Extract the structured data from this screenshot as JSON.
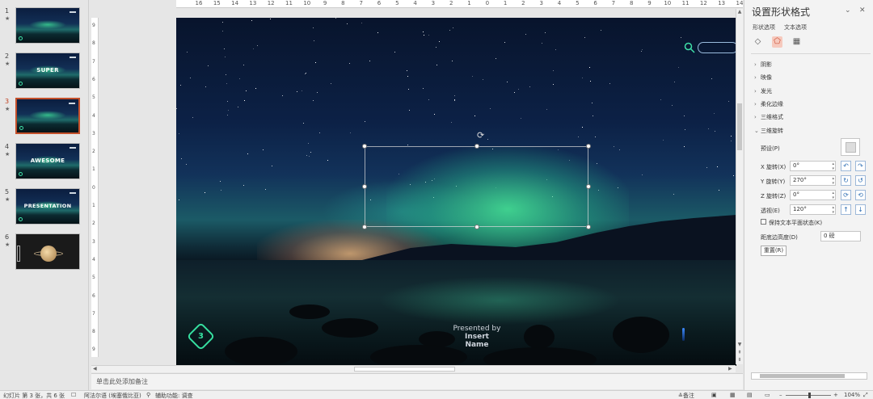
{
  "thumbnails": [
    {
      "num": "1",
      "star": "★",
      "word": "",
      "active": false
    },
    {
      "num": "2",
      "star": "★",
      "word": "SUPER",
      "active": false
    },
    {
      "num": "3",
      "star": "★",
      "word": "",
      "active": true
    },
    {
      "num": "4",
      "star": "★",
      "word": "AWESOME",
      "active": false
    },
    {
      "num": "5",
      "star": "★",
      "word": "PRESENTATION",
      "active": false
    },
    {
      "num": "6",
      "star": "★",
      "word": "",
      "active": false
    }
  ],
  "ruler": {
    "h_ticks": [
      "16",
      "15",
      "14",
      "13",
      "12",
      "11",
      "10",
      "9",
      "8",
      "7",
      "6",
      "5",
      "4",
      "3",
      "2",
      "1",
      "0",
      "1",
      "2",
      "3",
      "4",
      "5",
      "6",
      "7",
      "8",
      "9",
      "10",
      "11",
      "12",
      "13",
      "14"
    ],
    "v_ticks": [
      "9",
      "8",
      "7",
      "6",
      "5",
      "4",
      "3",
      "2",
      "1",
      "0",
      "1",
      "2",
      "3",
      "4",
      "5",
      "6",
      "7",
      "8",
      "9"
    ]
  },
  "slide": {
    "presented_line1": "Presented by",
    "presented_bold": "Insert",
    "presented_line2": "Name",
    "badge": "3"
  },
  "notes": {
    "placeholder": "单击此处添加备注"
  },
  "pane": {
    "title": "设置形状格式",
    "tabs": [
      "形状选项",
      "文本选项"
    ],
    "sections": [
      "阴影",
      "映像",
      "发光",
      "柔化边缘",
      "三维格式",
      "三维旋转"
    ],
    "preset_label": "预设(P)",
    "x_label": "X 旋转(X)",
    "x_value": "0°",
    "y_label": "Y 旋转(Y)",
    "y_value": "270°",
    "z_label": "Z 旋转(Z)",
    "z_value": "0°",
    "persp_label": "透视(E)",
    "persp_value": "120°",
    "keep_flat": "保持文本平面状态(K)",
    "dist_label": "距底边高度(D)",
    "dist_value": "0 磅",
    "reset": "重置(R)"
  },
  "status": {
    "slide_info": "幻灯片 第 3 张，共 6 张",
    "language": "阿法尔语 (埃塞俄比亚)",
    "accessibility": "辅助功能: 调查",
    "notes_btn": "≙备注",
    "zoom": "104%"
  }
}
